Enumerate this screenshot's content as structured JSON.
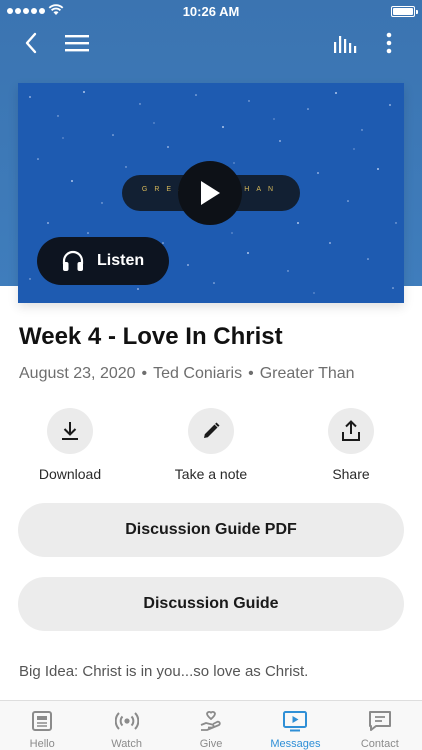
{
  "status_bar": {
    "time": "10:26 AM"
  },
  "icons": {
    "back": "chevron-left-icon",
    "menu": "hamburger-icon",
    "audio": "audio-bars-icon",
    "more": "more-vertical-icon",
    "play": "play-icon",
    "headphones": "headphones-icon",
    "download": "download-icon",
    "note": "pencil-icon",
    "share": "share-icon"
  },
  "media": {
    "series_text": "GREATER THAN",
    "listen_label": "Listen"
  },
  "message": {
    "title": "Week 4 - Love In Christ",
    "date": "August 23, 2020",
    "speaker": "Ted Coniaris",
    "series": "Greater Than",
    "separator": "•"
  },
  "actions": [
    {
      "label": "Download"
    },
    {
      "label": "Take a note"
    },
    {
      "label": "Share"
    }
  ],
  "buttons": {
    "guide_pdf": "Discussion Guide PDF",
    "guide": "Discussion Guide"
  },
  "big_idea": "Big Idea: Christ is in you...so love as Christ.",
  "tabs": [
    {
      "label": "Hello",
      "icon": "news-icon"
    },
    {
      "label": "Watch",
      "icon": "broadcast-icon"
    },
    {
      "label": "Give",
      "icon": "give-hand-icon"
    },
    {
      "label": "Messages",
      "icon": "tv-play-icon",
      "active": true
    },
    {
      "label": "Contact",
      "icon": "chat-icon"
    }
  ],
  "colors": {
    "header_blue": "#3b74b1",
    "media_blue": "#1e5bb1",
    "active_tab": "#2f8fd6"
  }
}
